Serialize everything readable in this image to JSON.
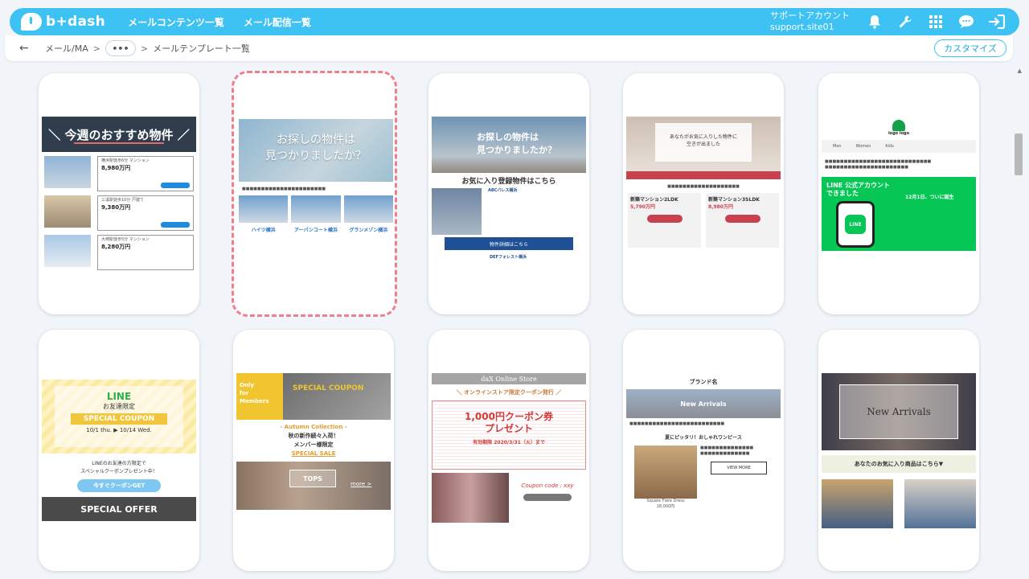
{
  "app": {
    "logo_text": "b+dash",
    "nav": [
      "メールコンテンツ一覧",
      "メール配信一覧"
    ],
    "account_name": "サポートアカウント",
    "account_site": "support.site01"
  },
  "icons": [
    "bell-icon",
    "wrench-icon",
    "grid-icon",
    "chat-icon",
    "logout-icon"
  ],
  "breadcrumb": {
    "back": "←",
    "items": [
      "メール/MA",
      "メールテンプレート一覧"
    ],
    "separator": ">",
    "ellipsis": "•••"
  },
  "customize_label": "カスタマイズ",
  "colors": {
    "brand": "#3ec1f3",
    "selected_border": "#ef7f8a",
    "background": "#f1f5f9"
  },
  "selected_template_index": 1,
  "templates": [
    {
      "title": "＼ 今週のおすすめ物件 ／",
      "items": [
        {
          "desc": "横浜駅徒歩6分 マンション",
          "price": "8,980万円"
        },
        {
          "desc": "三溪駅徒歩10分 戸建て",
          "price": "9,380万円"
        },
        {
          "desc": "大崎駅徒歩5分 マンション",
          "price": "8,280万円"
        }
      ]
    },
    {
      "hero": "お探しの物件は\n見つかりましたか？",
      "names": [
        "ハイツ横浜",
        "アーバンコート横浜",
        "グランメゾン横浜"
      ]
    },
    {
      "hero": "お探しの物件は\n見つかりましたか？",
      "title": "お気に入り登録物件はこちら",
      "item1": "ABCパレス横浜",
      "button": "物件詳細はこちら",
      "item2": "DEFフォレスト横浜"
    },
    {
      "hero": "あなたがお気に入りした物件に\n空きが出ました",
      "col1": "新築マンション2LDK",
      "col2": "新築マンション3SLDK",
      "price1": "5,790万円",
      "price2": "8,980万円"
    },
    {
      "logo": "logo logo",
      "tabs": [
        "Men",
        "Women",
        "Kids"
      ],
      "headline": "LINE 公式アカウント\nできました",
      "date": "12月1日、ついに誕生"
    },
    {
      "line": "LINE",
      "limited": "お友達限定",
      "coupon": "SPECIAL COUPON",
      "dates": "10/1 thu. ▶ 10/14 Wed.",
      "message": "LINEのお友達の方限定で\nスペシャルクーポンプレゼント中！",
      "get_button": "今すぐクーポンGET",
      "offer": "SPECIAL OFFER"
    },
    {
      "tag": "Only\nfor\nMembers",
      "coupon": "SPECIAL COUPON",
      "collection": "- Autumn Collection -",
      "line1": "秋の新作続々入荷！",
      "line2": "メンバー様限定",
      "sale": "SPECIAL SALE",
      "tops": "TOPS",
      "more": "more >"
    },
    {
      "store": "daX Online Store",
      "subtitle": "＼ オンラインストア限定クーポン発行 ／",
      "amount": "1,000円クーポン券",
      "present": "プレゼント",
      "period": "有効期限 2020/3/31（火）まで",
      "code": "Coupon code : xxy"
    },
    {
      "brand": "ブランド名",
      "arrivals": "New Arrivals",
      "title": "夏にピッタリ！おしゃれワンピース",
      "button": "VIEW MORE",
      "product": "Square Flare Dress",
      "price": "18,000円"
    },
    {
      "arrivals": "New Arrivals",
      "band": "あなたのお気に入り商品はこちら▼"
    }
  ]
}
